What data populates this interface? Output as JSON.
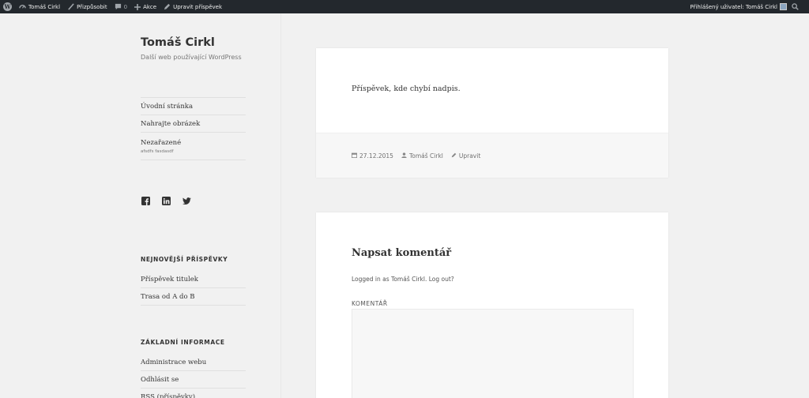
{
  "adminbar": {
    "site_name": "Tomáš Cirkl",
    "customize": "Přizpůsobit",
    "comments_count": "0",
    "new": "Akce",
    "edit_post": "Upravit příspěvek",
    "logged_user": "Přihlášený uživatel: Tomáš Cirkl"
  },
  "site": {
    "title": "Tomáš Cirkl",
    "description": "Další web používající WordPress"
  },
  "menu": [
    {
      "label": "Úvodní stránka"
    },
    {
      "label": "Nahrajte obrázek"
    },
    {
      "label": "Nezařazené",
      "sub": "afsdfs fasdasdf"
    }
  ],
  "social": [
    "facebook-icon",
    "linkedin-icon",
    "twitter-icon"
  ],
  "recent_posts": {
    "title": "NEJNOVĚJŠÍ PŘÍSPĚVKY",
    "items": [
      "Příspěvek titulek",
      "Trasa od A do B"
    ]
  },
  "meta": {
    "title": "ZÁKLADNÍ INFORMACE",
    "items": [
      "Administrace webu",
      "Odhlásit se",
      "RSS (příspěvky)"
    ]
  },
  "post": {
    "content": "Příspěvek, kde chybí nadpis.",
    "date": "27.12.2015",
    "author": "Tomáš Cirkl",
    "edit": "Upravit"
  },
  "comment_form": {
    "title": "Napsat komentář",
    "logged_in": "Logged in as Tomáš Cirkl. Log out?",
    "label": "KOMENTÁŘ",
    "value": ""
  },
  "colors": {
    "adminbar_bg": "#23282d",
    "page_bg": "#f1f1f1",
    "card_bg": "#ffffff"
  }
}
